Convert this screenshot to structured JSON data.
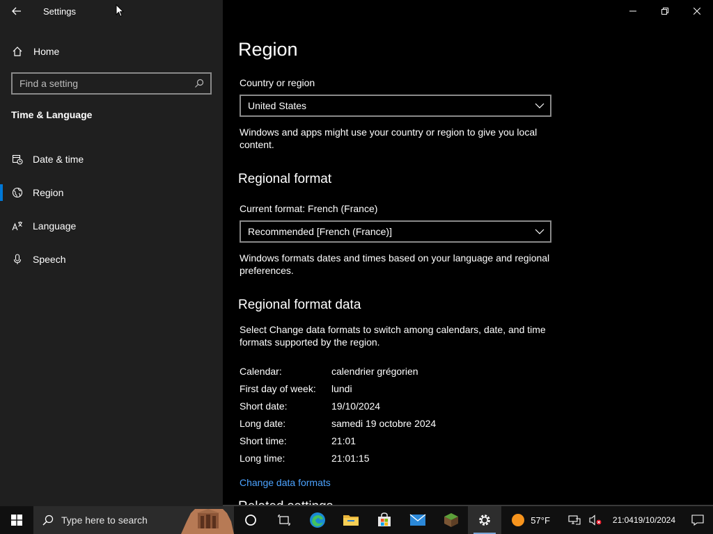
{
  "app": {
    "title": "Settings"
  },
  "sidebar": {
    "home_label": "Home",
    "search_placeholder": "Find a setting",
    "section_title": "Time & Language",
    "items": [
      {
        "label": "Date & time",
        "icon": "calendar-clock-icon",
        "active": false
      },
      {
        "label": "Region",
        "icon": "globe-icon",
        "active": true
      },
      {
        "label": "Language",
        "icon": "language-icon",
        "active": false
      },
      {
        "label": "Speech",
        "icon": "microphone-icon",
        "active": false
      }
    ]
  },
  "main": {
    "title": "Region",
    "country": {
      "label": "Country or region",
      "value": "United States",
      "description": "Windows and apps might use your country or region to give you local content."
    },
    "regional_format": {
      "heading": "Regional format",
      "label": "Current format: French (France)",
      "value": "Recommended [French (France)]",
      "description": "Windows formats dates and times based on your language and regional preferences."
    },
    "format_data": {
      "heading": "Regional format data",
      "description": "Select Change data formats to switch among calendars, date, and time formats supported by the region.",
      "rows": [
        {
          "key": "Calendar:",
          "value": "calendrier grégorien"
        },
        {
          "key": "First day of week:",
          "value": "lundi"
        },
        {
          "key": "Short date:",
          "value": "19/10/2024"
        },
        {
          "key": "Long date:",
          "value": "samedi 19 octobre 2024"
        },
        {
          "key": "Short time:",
          "value": "21:01"
        },
        {
          "key": "Long time:",
          "value": "21:01:15"
        }
      ],
      "link": "Change data formats"
    },
    "next_heading": "Related settings"
  },
  "taskbar": {
    "search_placeholder": "Type here to search",
    "weather": "57°F",
    "time": "21:04",
    "date": "19/10/2024"
  },
  "colors": {
    "accent": "#0078d7",
    "link": "#4ca3ff",
    "sidebar_bg": "#1f1f1f"
  }
}
